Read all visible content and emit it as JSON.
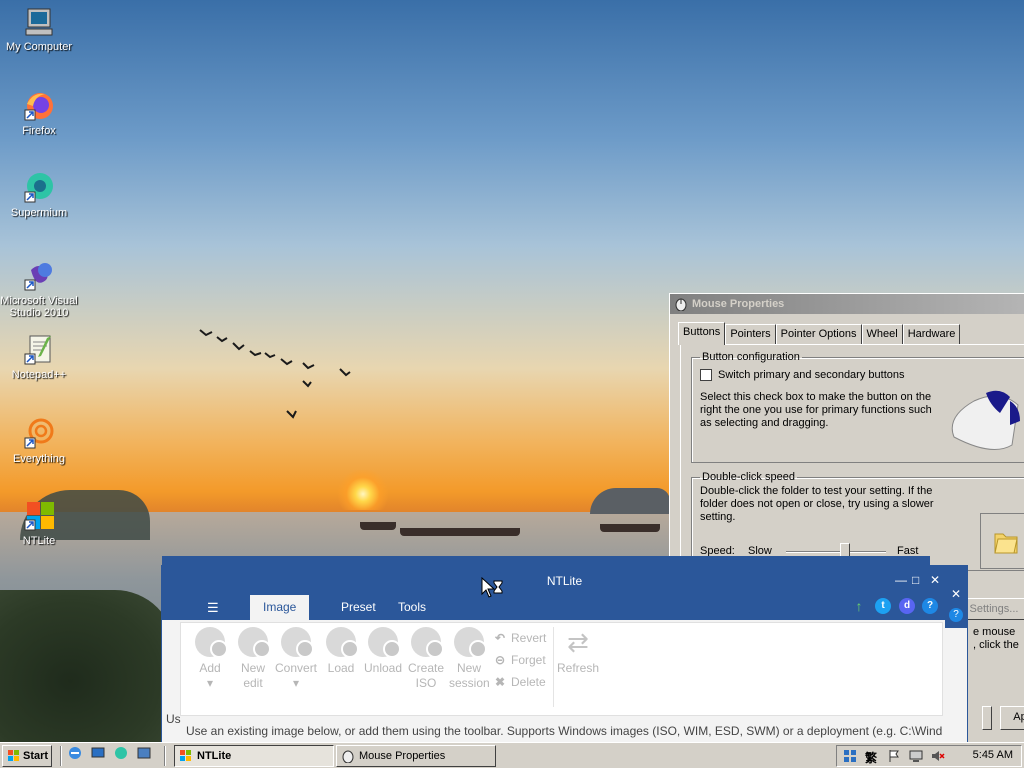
{
  "desktop": {
    "icons": [
      {
        "label": "My Computer"
      },
      {
        "label": "Firefox"
      },
      {
        "label": "Supermium"
      },
      {
        "label": "Microsoft Visual Studio 2010"
      },
      {
        "label": "Notepad++"
      },
      {
        "label": "Everything"
      },
      {
        "label": "NTLite"
      }
    ]
  },
  "mouse_properties": {
    "title": "Mouse Properties",
    "tabs": [
      "Buttons",
      "Pointers",
      "Pointer Options",
      "Wheel",
      "Hardware"
    ],
    "active_tab": "Buttons",
    "button_config": {
      "legend": "Button configuration",
      "checkbox_label": "Switch primary and secondary buttons",
      "checked": false,
      "description": "Select this check box to make the button on the right the one you use for primary functions such as selecting and dragging."
    },
    "double_click": {
      "legend": "Double-click speed",
      "description": "Double-click the folder to test your setting. If the folder does not open or close, try using a slower setting.",
      "speed_label": "Speed:",
      "slow_label": "Slow",
      "fast_label": "Fast",
      "speed_value": 0.6
    },
    "partial": {
      "settings_button": "Settings...",
      "text_line1": "e mouse",
      "text_line2": ", click the",
      "apply_button": "Ap"
    }
  },
  "ntlite": {
    "title": "NTLite",
    "menu_icon": "☰",
    "tabs": [
      "Image",
      "Preset",
      "Tools"
    ],
    "active_tab": "Image",
    "ribbon": {
      "buttons": [
        {
          "label": "Add",
          "sub": "▾"
        },
        {
          "label": "New edit",
          "sub": ""
        },
        {
          "label": "Convert",
          "sub": "▾"
        },
        {
          "label": "Load",
          "sub": ""
        },
        {
          "label": "Unload",
          "sub": ""
        },
        {
          "label": "Create ISO",
          "sub": ""
        },
        {
          "label": "New session",
          "sub": ""
        }
      ],
      "small": [
        "Revert",
        "Forget",
        "Delete"
      ],
      "refresh": "Refresh"
    },
    "status": "Use an existing image below, or add them using the toolbar. Supports Windows images (ISO, WIM, ESD, SWM) or a deployment (e.g. C:\\Wind...",
    "status_left": "Us"
  },
  "taskbar": {
    "start": "Start",
    "tasks": [
      {
        "label": "NTLite",
        "active": true
      },
      {
        "label": "Mouse Properties",
        "active": false
      }
    ],
    "clock": "5:45 AM"
  },
  "colors": {
    "ntlite_blue": "#2b579a",
    "win95_face": "#d4d0c8"
  }
}
